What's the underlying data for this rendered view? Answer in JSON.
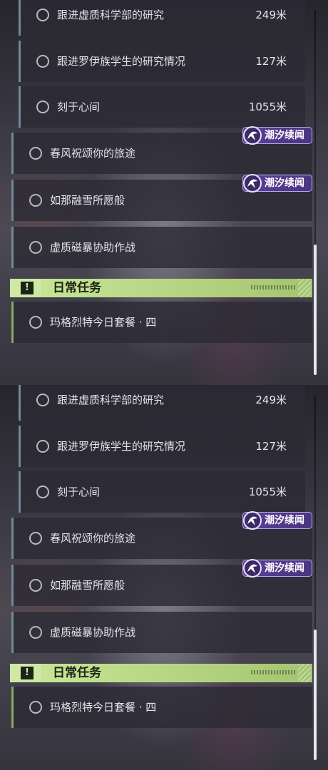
{
  "panels": [
    {
      "quests": [
        {
          "title": "跟进虚质科学部的研究",
          "distance": "249米"
        },
        {
          "title": "跟进罗伊族学生的研究情况",
          "distance": "127米"
        },
        {
          "title": "刻于心间",
          "distance": "1055米"
        },
        {
          "title": "春风祝颂你的旅途",
          "tag": "潮汐续闻"
        },
        {
          "title": "如那融雪所愿般",
          "tag": "潮汐续闻"
        },
        {
          "title": "虚质磁暴协助作战"
        }
      ],
      "daily_header": "日常任务",
      "daily_quests": [
        {
          "title": "玛格烈特今日套餐 · 四"
        }
      ]
    },
    {
      "quests": [
        {
          "title": "跟进虚质科学部的研究",
          "distance": "249米"
        },
        {
          "title": "跟进罗伊族学生的研究情况",
          "distance": "127米"
        },
        {
          "title": "刻于心间",
          "distance": "1055米"
        },
        {
          "title": "春风祝颂你的旅途",
          "tag": "潮汐续闻"
        },
        {
          "title": "如那融雪所愿般",
          "tag": "潮汐续闻"
        },
        {
          "title": "虚质磁暴协助作战"
        }
      ],
      "daily_header": "日常任务",
      "daily_quests": [
        {
          "title": "玛格烈特今日套餐 · 四"
        }
      ]
    }
  ],
  "colors": {
    "tag_purple": "#5b3f9a",
    "daily_green": "#b6d583",
    "quest_border": "#6f8a97"
  },
  "icons": {
    "quest_status": "circle-icon",
    "tag_logo": "tidal-logo-icon",
    "daily_badge": "exclamation-icon"
  }
}
